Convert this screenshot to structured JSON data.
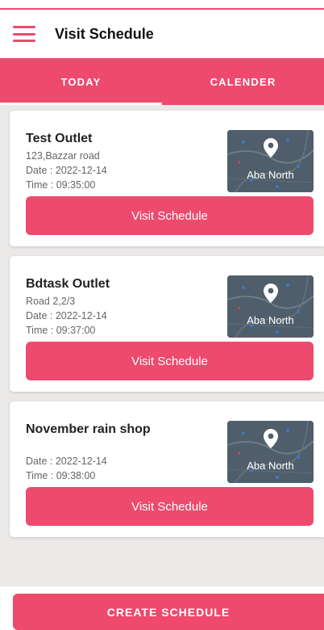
{
  "theme": {
    "accent": "#ed4a6d"
  },
  "appbar": {
    "menu_icon": "hamburger-menu-icon",
    "title": "Visit Schedule"
  },
  "tabs": [
    {
      "label": "TODAY",
      "active": true
    },
    {
      "label": "CALENDER",
      "active": false
    }
  ],
  "schedules": [
    {
      "name": "Test Outlet",
      "address": "123,Bazzar road",
      "date": "Date : 2022-12-14",
      "time": "Time : 09:35:00",
      "area": "Aba North",
      "button": "Visit Schedule"
    },
    {
      "name": "Bdtask Outlet",
      "address": "Road 2,2/3",
      "date": "Date : 2022-12-14",
      "time": "Time : 09:37:00",
      "area": "Aba North",
      "button": "Visit Schedule"
    },
    {
      "name": "November rain shop",
      "address": "",
      "date": "Date : 2022-12-14",
      "time": "Time : 09:38:00",
      "area": "Aba North",
      "button": "Visit Schedule"
    }
  ],
  "footer": {
    "create_label": "CREATE SCHEDULE"
  }
}
